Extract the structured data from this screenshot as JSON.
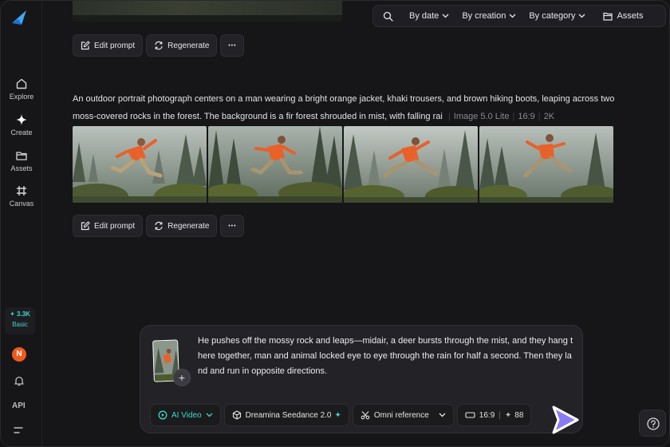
{
  "sidebar": {
    "items": [
      {
        "label": "Explore",
        "icon": "home-icon"
      },
      {
        "label": "Create",
        "icon": "sparkle-icon"
      },
      {
        "label": "Assets",
        "icon": "folder-icon"
      },
      {
        "label": "Canvas",
        "icon": "grid-icon"
      }
    ],
    "credits": "3.3K",
    "plan": "Basic",
    "avatar_initial": "N",
    "api_label": "API"
  },
  "toolbar": {
    "by_date": "By date",
    "by_creation": "By creation",
    "by_category": "By category",
    "assets": "Assets"
  },
  "actions": {
    "edit_prompt": "Edit prompt",
    "regenerate": "Regenerate",
    "more": "•••"
  },
  "generation": {
    "prompt": "An outdoor portrait photograph centers on a man wearing a bright orange jacket, khaki trousers, and brown hiking boots, leaping across two moss-covered rocks in the forest. The background is a fir forest shrouded in mist, with falling rai",
    "model": "Image 5.0 Lite",
    "ratio": "16:9",
    "resolution": "2K",
    "image_count": 4
  },
  "composer": {
    "text": "He pushes off the mossy rock and leaps—midair, a deer bursts through the mist, and they hang there together, man and animal locked eye to eye through the rain for half a second. Then they land and run in opposite directions.",
    "mode": "AI Video",
    "model": "Dreamina Seedance 2.0",
    "reference": "Omni reference",
    "ratio": "16:9",
    "cost": "88"
  },
  "colors": {
    "accent": "#3fd6c6",
    "send": "#8a7cf5",
    "avatar": "#ef5a1e",
    "jacket": "#e8612a"
  }
}
